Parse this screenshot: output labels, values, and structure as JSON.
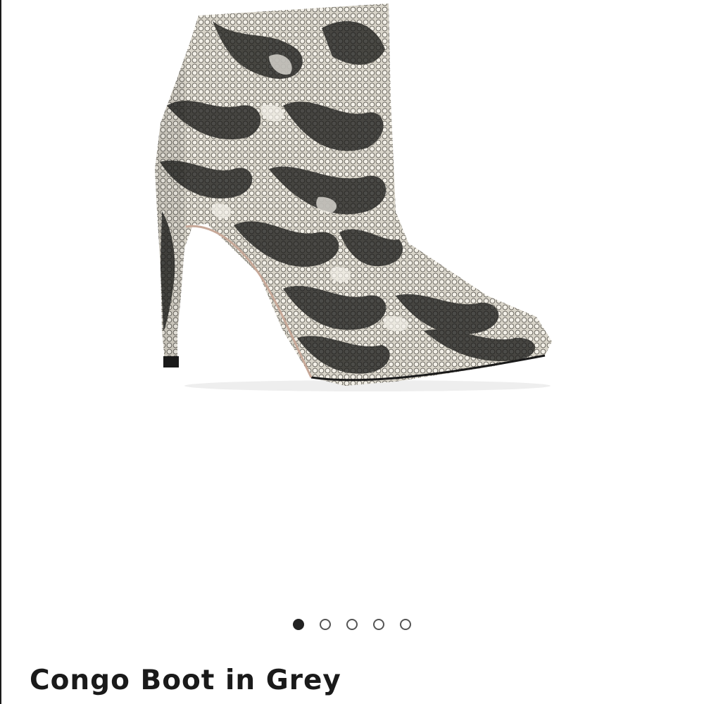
{
  "product": {
    "title": "Congo Boot in Grey",
    "image_icon": "snakeskin-ankle-boot-image"
  },
  "carousel": {
    "total_slides": 5,
    "active_index": 0,
    "dot_labels": [
      "slide 1",
      "slide 2",
      "slide 3",
      "slide 4",
      "slide 5"
    ]
  },
  "colors": {
    "text": "#1a1a1a",
    "dot_active": "#222222",
    "dot_border": "#555555",
    "snake_light": "#e7e3d8",
    "snake_mid": "#8f8b80",
    "snake_dark": "#1d1d1b"
  }
}
